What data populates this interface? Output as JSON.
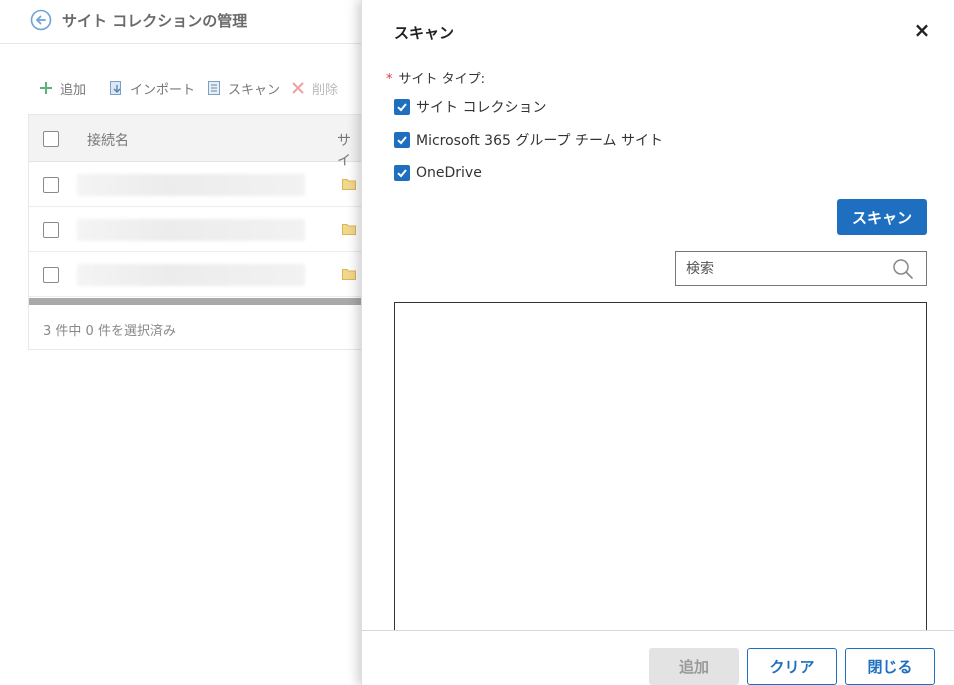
{
  "background": {
    "page_title": "サイト コレクションの管理",
    "toolbar": {
      "add_label": "追加",
      "import_label": "インポート",
      "scan_label": "スキャン",
      "delete_label": "削除"
    },
    "grid": {
      "col_name": "接続名",
      "col_site": "サイ",
      "rows": 3,
      "footer_text": "3 件中 0 件を選択済み"
    }
  },
  "scan_panel": {
    "title": "スキャン",
    "close_symbol": "×",
    "site_type_required": "*",
    "site_type_label": "サイト タイプ:",
    "options": [
      {
        "label": "サイト コレクション",
        "checked": true
      },
      {
        "label": "Microsoft 365 グループ チーム サイト",
        "checked": true
      },
      {
        "label": "OneDrive",
        "checked": true
      }
    ],
    "scan_button": "スキャン",
    "search_placeholder": "検索",
    "footer": {
      "add_label": "追加",
      "clear_label": "クリア",
      "close_label": "閉じる"
    }
  },
  "colors": {
    "accent": "#1f6fc0",
    "disabled_bg": "#e3e3e3",
    "required": "#e0383e"
  }
}
